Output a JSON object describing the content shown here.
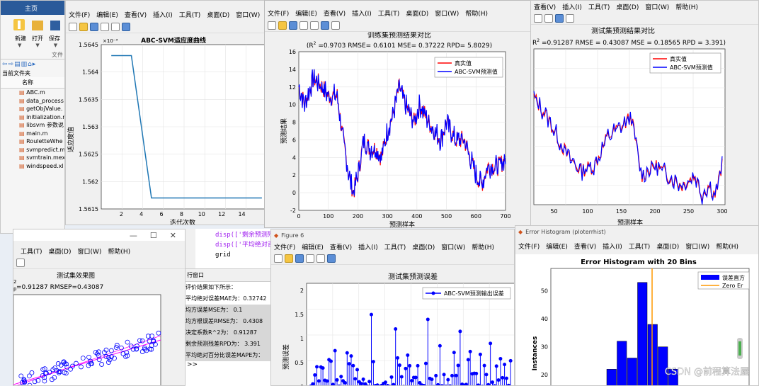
{
  "matlab": {
    "tab_home": "主页",
    "new_label": "新建",
    "open_label": "打开",
    "save_label": "保存",
    "file_group": "文件",
    "current_folder": "当前文件夹",
    "name_header": "名称",
    "files": [
      "ABC.m",
      "data_process",
      "getObjValue.",
      "initialization.r",
      "libsvm 参数说",
      "main.m",
      "RouletteWhe",
      "svmpredict.m",
      "svmtrain.mex",
      "windspeed.xl"
    ]
  },
  "fig_fitness": {
    "menu": [
      "文件(F)",
      "编辑(E)",
      "查看(V)",
      "插入(I)",
      "工具(T)",
      "桌面(D)",
      "窗口(W)",
      "帮助(H)"
    ],
    "title": "ABC-SVM适应度曲线",
    "xlabel": "迭代次数",
    "ylabel": "适应度值",
    "exponent": "×10⁻³",
    "yticks": [
      "1.5645",
      "1.564",
      "1.5635",
      "1.563",
      "1.5625",
      "1.562",
      "1.5615"
    ],
    "xticks": [
      "2",
      "4",
      "6",
      "8",
      "10",
      "12",
      "14"
    ]
  },
  "fig_train": {
    "menu": [
      "文件(F)",
      "编辑(E)",
      "查看(V)",
      "插入(I)",
      "工具(T)",
      "桌面(D)",
      "窗口(W)",
      "帮助(H)"
    ],
    "title": "训练集预测结果对比",
    "subtitle_prefix": "(R",
    "subtitle_suffix": " =0.9703 RMSE= 0.6101 MSE= 0.37222 RPD= 5.8029)",
    "xlabel": "预测样本",
    "ylabel": "预测结果",
    "legend": [
      "真实值",
      "ABC-SVM预测值"
    ],
    "yticks": [
      "16",
      "14",
      "12",
      "10",
      "8",
      "6",
      "4",
      "2",
      "0",
      "-2"
    ],
    "xticks": [
      "0",
      "100",
      "200",
      "300",
      "400",
      "500",
      "600",
      "700"
    ]
  },
  "fig_test": {
    "menu": [
      "查看(V)",
      "插入(I)",
      "工具(T)",
      "桌面(D)",
      "窗口(W)",
      "帮助(H)"
    ],
    "title": "测试集预测结果对比",
    "subtitle_prefix": "R",
    "subtitle_suffix": " =0.91287 RMSE = 0.43087 MSE = 0.18565 RPD = 3.391)",
    "xlabel": "预测样本",
    "legend": [
      "真实值",
      "ABC-SVM预测值"
    ],
    "xticks": [
      "50",
      "100",
      "150",
      "200",
      "250",
      "300"
    ]
  },
  "fig_scatter": {
    "menu": [
      "工具(T)",
      "桌面(D)",
      "窗口(W)",
      "帮助(H)"
    ],
    "title": "测试集效果图",
    "subtitle": "=0.91287  RMSEP=0.43087",
    "exp_mark": "2",
    "p_mark": "p"
  },
  "console": {
    "code_lines": [
      "disp(['剩余预测残差",
      "disp(['平均绝对百分",
      "grid"
    ],
    "panel_title": "行窗口",
    "output_lines": [
      "评价结果如下所示：",
      "平均绝对误差MAE为：0.32742",
      "均方误差MSE为：        0.1",
      "均方根误差RMSE为：      0.4308",
      "决定系数R^2为：   0.91287",
      "剩余预测残差RPD为：     3.391",
      "平均绝对百分比误差MAPE为："
    ],
    "prompt": ">>"
  },
  "fig_error": {
    "window_title": "Figure 6",
    "menu": [
      "文件(F)",
      "编辑(E)",
      "查看(V)",
      "插入(I)",
      "工具(T)",
      "桌面(D)",
      "窗口(W)",
      "帮助(H)"
    ],
    "title": "测试集预测误差",
    "ylabel": "预测误差",
    "legend": "ABC-SVM预测输出误差",
    "yticks": [
      "2",
      "1.5",
      "1",
      "0.5",
      "0"
    ]
  },
  "fig_hist": {
    "window_title": "Error Histogram (ploterrhist)",
    "menu": [
      "文件(F)",
      "编辑(E)",
      "查看(V)",
      "插入(I)",
      "工具(T)",
      "桌面(D)",
      "窗口(W)",
      "帮助(H)"
    ],
    "title": "Error Histogram with 20 Bins",
    "ylabel": "Instances",
    "legend": [
      "误差直方",
      "Zero Er"
    ],
    "yticks": [
      "50",
      "40",
      "30",
      "20"
    ],
    "watermark": "CSDN @前程算法屋"
  },
  "chart_data": [
    {
      "type": "line",
      "title": "ABC-SVM适应度曲线",
      "xlabel": "迭代次数",
      "ylabel": "适应度值",
      "series": [
        {
          "values": [
            0.0015643,
            0.0015643,
            0.0015643,
            0.0015617,
            0.0015617,
            0.0015617,
            0.0015617,
            0.0015617,
            0.0015617,
            0.0015617,
            0.0015617,
            0.0015617,
            0.0015617,
            0.0015617,
            0.0015617
          ]
        }
      ],
      "x": [
        1,
        2,
        3,
        5,
        6,
        7,
        8,
        9,
        10,
        11,
        12,
        13,
        14,
        15,
        16
      ],
      "ylim": [
        0.0015615,
        0.0015645
      ],
      "grid": true
    },
    {
      "type": "line",
      "title": "训练集预测结果对比",
      "xlabel": "预测样本",
      "ylabel": "预测结果",
      "xlim": [
        0,
        700
      ],
      "ylim": [
        -2,
        16
      ],
      "series": [
        {
          "name": "真实值",
          "color": "#ff0000"
        },
        {
          "name": "ABC-SVM预测值",
          "color": "#0000ff"
        }
      ],
      "anchors_x": [
        0,
        20,
        50,
        80,
        100,
        130,
        150,
        170,
        185,
        200,
        220,
        240,
        260,
        280,
        300,
        320,
        340,
        360,
        375,
        390,
        410,
        440,
        460,
        480,
        500,
        530,
        560,
        580,
        600,
        620,
        640,
        660,
        680,
        700
      ],
      "anchors_y": [
        12,
        10,
        13,
        12,
        11,
        11,
        6,
        2,
        0,
        2,
        6,
        5,
        5,
        4,
        7,
        9,
        12,
        10,
        9,
        8,
        10,
        8,
        7,
        6,
        8,
        6,
        6,
        4,
        2,
        1,
        3,
        3,
        3,
        4
      ],
      "grid": true
    },
    {
      "type": "line",
      "title": "测试集预测结果对比",
      "xlabel": "预测样本",
      "xlim": [
        0,
        300
      ],
      "series": [
        {
          "name": "真实值",
          "color": "#ff0000"
        },
        {
          "name": "ABC-SVM预测值",
          "color": "#0000ff"
        }
      ],
      "grid": true
    },
    {
      "type": "scatter",
      "title": "测试集效果图"
    },
    {
      "type": "line",
      "title": "测试集预测误差",
      "ylabel": "预测误差",
      "ylim": [
        0,
        2
      ],
      "series": [
        {
          "name": "ABC-SVM预测输出误差",
          "color": "#0000ff"
        }
      ],
      "grid": true
    },
    {
      "type": "bar",
      "title": "Error Histogram with 20 Bins",
      "ylabel": "Instances",
      "values": [
        5,
        15,
        22,
        32,
        26,
        53,
        38,
        30,
        22,
        12,
        5
      ],
      "ylim": [
        15,
        58
      ],
      "series": [
        {
          "name": "误差直方",
          "color": "#0000ff"
        },
        {
          "name": "Zero Er",
          "color": "#ff9900"
        }
      ]
    }
  ]
}
